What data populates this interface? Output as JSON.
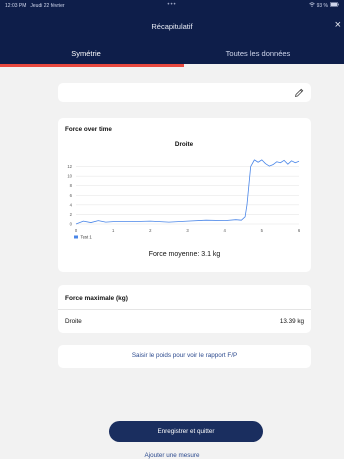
{
  "status_bar": {
    "time": "12:03 PM",
    "date": "Jeudi 22 février",
    "dots": "•••",
    "battery": "93 %"
  },
  "header": {
    "title": "Récapitulatif",
    "close_icon": "close-icon",
    "tabs": [
      {
        "label": "Symétrie",
        "active": true
      },
      {
        "label": "Toutes les données",
        "active": false
      }
    ],
    "accent_color": "#e8493f",
    "bg_color": "#0e1e4a"
  },
  "search": {
    "value": "",
    "edit_icon": "pencil-icon"
  },
  "chart_card": {
    "heading": "Force over time",
    "average_label": "Force moyenne: 3.1 kg"
  },
  "chart_data": {
    "type": "line",
    "title": "Droite",
    "xlabel": "",
    "ylabel": "",
    "xlim": [
      0,
      6
    ],
    "ylim": [
      0,
      14
    ],
    "x_ticks": [
      0,
      1,
      2,
      3,
      4,
      5,
      6
    ],
    "y_ticks": [
      0,
      2,
      4,
      6,
      8,
      10,
      12
    ],
    "grid": true,
    "legend_position": "bottom-left",
    "series": [
      {
        "name": "Test 1",
        "color": "#4a86e8",
        "x": [
          0,
          0.2,
          0.4,
          0.6,
          0.8,
          1.0,
          1.5,
          2.0,
          2.5,
          3.0,
          3.5,
          4.0,
          4.3,
          4.45,
          4.55,
          4.6,
          4.65,
          4.7,
          4.8,
          4.9,
          5.0,
          5.1,
          5.2,
          5.3,
          5.4,
          5.5,
          5.6,
          5.7,
          5.8,
          5.9,
          6.0
        ],
        "y": [
          0,
          0.6,
          0.3,
          0.7,
          0.4,
          0.5,
          0.5,
          0.6,
          0.4,
          0.6,
          0.8,
          0.7,
          0.9,
          0.8,
          1.5,
          4,
          8,
          12,
          13.4,
          12.9,
          13.4,
          12.6,
          12.1,
          12.4,
          13.0,
          12.8,
          13.3,
          12.5,
          13.2,
          12.8,
          13.1
        ]
      }
    ]
  },
  "max_card": {
    "heading": "Force maximale (kg)",
    "rows": [
      {
        "label": "Droite",
        "value": "13.39 kg"
      }
    ]
  },
  "ratio_card": {
    "link": "Saisir le poids pour voir le rapport F/P"
  },
  "footer": {
    "save_label": "Enregistrer et quitter",
    "add_label": "Ajouter une mesure",
    "button_color": "#1a2e5f"
  }
}
